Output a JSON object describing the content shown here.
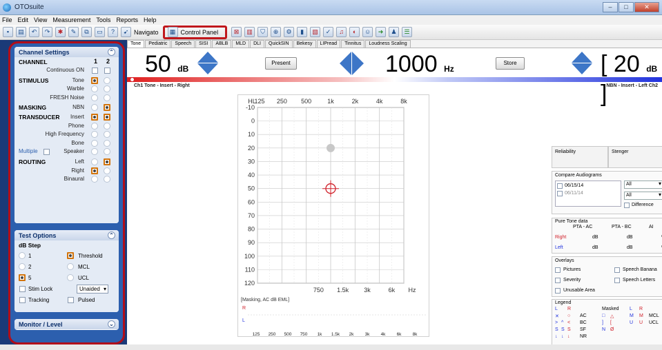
{
  "window": {
    "title": "OTOsuite"
  },
  "menu": [
    "File",
    "Edit",
    "View",
    "Measurement",
    "Tools",
    "Reports",
    "Help"
  ],
  "toolbar": {
    "navigator_label": "Navigato",
    "control_panel_label": "Control Panel"
  },
  "channel_settings": {
    "title": "Channel Settings",
    "channel_label": "CHANNEL",
    "ch1": "1",
    "ch2": "2",
    "continuous_on": "Continuous ON",
    "stimulus": "STIMULUS",
    "tone": "Tone",
    "warble": "Warble",
    "fresh_noise": "FRESH Noise",
    "masking": "MASKING",
    "nbn": "NBN",
    "transducer": "TRANSDUCER",
    "insert": "Insert",
    "phone": "Phone",
    "high_frequency": "High Frequency",
    "bone": "Bone",
    "speaker": "Speaker",
    "multiple": "Multiple",
    "routing": "ROUTING",
    "left": "Left",
    "right": "Right",
    "binaural": "Binaural"
  },
  "test_options": {
    "title": "Test Options",
    "db_step": "dB Step",
    "step1": "1",
    "step2": "2",
    "step5": "5",
    "threshold": "Threshold",
    "mcl": "MCL",
    "ucl": "UCL",
    "stim_lock": "Stim Lock",
    "unaided": "Unaided",
    "tracking": "Tracking",
    "pulsed": "Pulsed"
  },
  "monitor": {
    "title": "Monitor / Level"
  },
  "tabs": [
    "Tone",
    "Pediatric",
    "Speech",
    "SISI",
    "ABLB",
    "MLD",
    "DLI",
    "QuickSIN",
    "Bekesy",
    "LIPread",
    "Tinnitus",
    "Loudness Scaling"
  ],
  "controls": {
    "left_db": "50",
    "db_unit": "dB",
    "present": "Present",
    "freq": "1000",
    "hz_unit": "Hz",
    "store": "Store",
    "right_bracket": "[",
    "right_db": "20",
    "right_bracket_close": "]"
  },
  "channel_labels": {
    "ch1": "Ch1 Tone - Insert - Right",
    "ch2": "NBN - Insert - Left Ch2"
  },
  "audiogram": {
    "hl_label": "HL",
    "freq_top": [
      "125",
      "250",
      "500",
      "1k",
      "2k",
      "4k",
      "8k"
    ],
    "freq_bottom": [
      "750",
      "1.5k",
      "3k",
      "6k"
    ],
    "hz_label": "Hz",
    "levels": [
      "-10",
      "0",
      "10",
      "20",
      "30",
      "40",
      "50",
      "60",
      "70",
      "80",
      "90",
      "100",
      "110",
      "120"
    ],
    "masking_title": "[Masking, AC dB EML]",
    "mask_r": "R",
    "mask_l": "L",
    "mask_freqs": [
      "125",
      "250",
      "500",
      "750",
      "1k",
      "1.5k",
      "2k",
      "3k",
      "4k",
      "6k",
      "8k"
    ],
    "points": [
      {
        "freq_index": 3.0,
        "db": 20,
        "type": "gray-dot"
      },
      {
        "freq_index": 3.0,
        "db": 50,
        "type": "red-crosshair"
      }
    ]
  },
  "right_panel": {
    "reliability": "Reliability",
    "stenger": "Stenger",
    "compare_title": "Compare Audiograms",
    "date1": "06/15/14",
    "date2": "06/11/14",
    "all1": "All",
    "all2": "All",
    "difference": "Difference",
    "pure_tone_title": "Pure Tone data",
    "pta_ac": "PTA - AC",
    "pta_bc": "PTA - BC",
    "ai": "AI",
    "right": "Right",
    "left": "Left",
    "db": "dB",
    "pct": "%",
    "overlays_title": "Overlays",
    "pictures": "Pictures",
    "speech_banana": "Speech Banana",
    "severity": "Severity",
    "speech_letters": "Speech Letters",
    "unusable_area": "Unusable Area",
    "legend_title": "Legend",
    "masked": "Masked",
    "lg_ac": "AC",
    "lg_bc": "BC",
    "lg_sf": "SF",
    "lg_nr": "NR",
    "lg_mcl": "MCL",
    "lg_ucl": "UCL"
  },
  "colors": {
    "accent": "#2c5fae",
    "highlight": "#c0171c",
    "right_red": "#d0202a",
    "left_blue": "#2233dd"
  }
}
